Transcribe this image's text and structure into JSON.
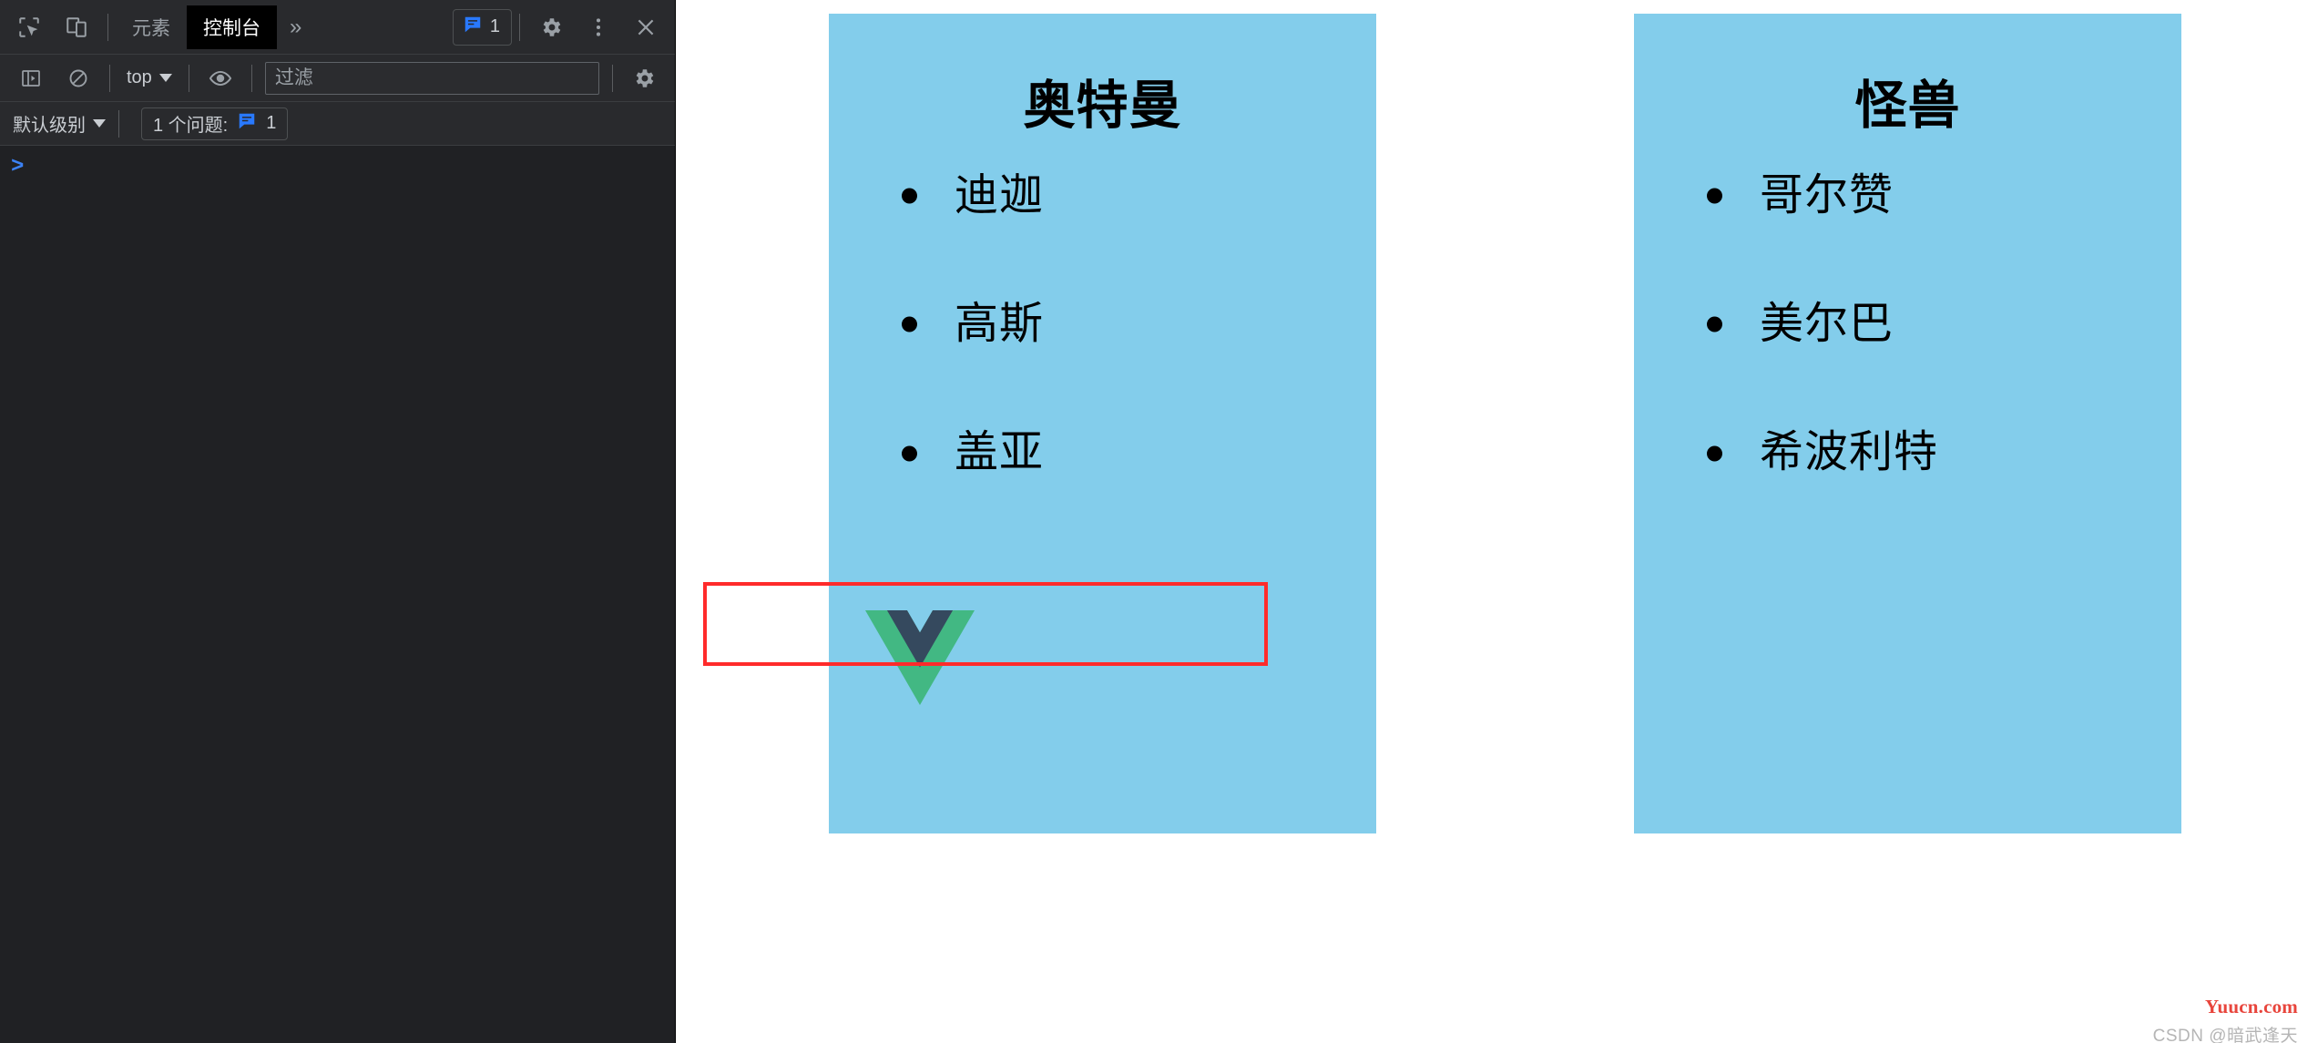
{
  "devtools": {
    "toolbar": {
      "inspect_icon": "inspect-element-icon",
      "device_icon": "device-toolbar-icon",
      "tabs": [
        {
          "label": "元素",
          "active": false
        },
        {
          "label": "控制台",
          "active": true
        }
      ],
      "more_tabs_label": "»",
      "issues_count": "1",
      "settings_icon": "gear-icon",
      "more_options_icon": "three-dot-menu-icon",
      "close_icon": "close-icon"
    },
    "filterbar": {
      "sidebar_toggle_icon": "console-sidebar-icon",
      "clear_console_icon": "clear-console-icon",
      "context_label": "top",
      "eye_icon": "live-expression-icon",
      "filter_placeholder": "过滤",
      "filter_value": "",
      "settings_icon": "gear-icon"
    },
    "levelbar": {
      "level_label": "默认级别",
      "problems_label": "1 个问题:",
      "problems_count": "1"
    },
    "console": {
      "prompt": ">"
    }
  },
  "page": {
    "cards": [
      {
        "title": "奥特曼",
        "items": [
          "迪迦",
          "高斯",
          "盖亚"
        ]
      },
      {
        "title": "怪兽",
        "items": [
          "哥尔赞",
          "美尔巴",
          "希波利特"
        ]
      }
    ],
    "logo": "vue-logo",
    "colors": {
      "card_background": "#83CDEB",
      "highlight_border": "#FF2B2B",
      "vue_green": "#42B883",
      "vue_navy": "#35495E"
    }
  },
  "watermarks": {
    "primary": "Yuucn.com",
    "secondary": "CSDN @暗武逢天"
  }
}
